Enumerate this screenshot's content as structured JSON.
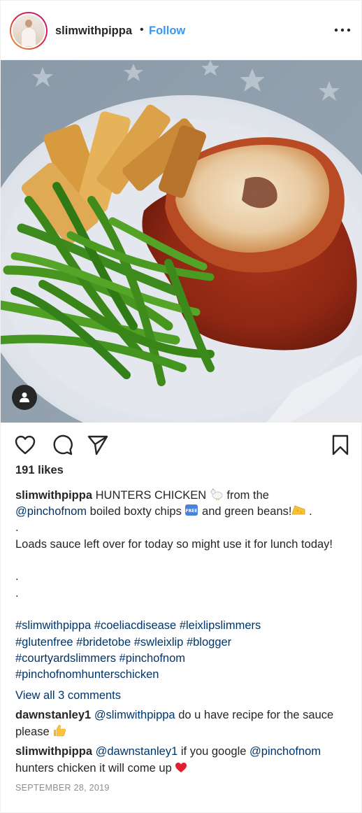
{
  "header": {
    "username": "slimwithpippa",
    "separator": "•",
    "follow_label": "Follow"
  },
  "photo": {
    "description_icon": "photo-food-plate",
    "tag_icon": "user-tag-icon"
  },
  "actions": {
    "like_icon": "heart-icon",
    "comment_icon": "comment-icon",
    "share_icon": "send-icon",
    "save_icon": "bookmark-icon"
  },
  "likes": "191 likes",
  "caption": {
    "username": "slimwithpippa",
    "line1_text": "HUNTERS CHICKEN",
    "line1_after": "from the",
    "mention": "@pinchofnom",
    "line2_text": "boiled boxty chips",
    "line2_after": "and green beans!",
    "line2_end": ".",
    "dot1": ".",
    "para": "Loads sauce left over for today so might use it for lunch today!",
    "dot2": ".",
    "dot3": ".",
    "hashtags": [
      "#slimwithpippa",
      "#coeliacdisease",
      "#leixlipslimmers",
      "#glutenfree",
      "#bridetobe",
      "#swleixlip",
      "#blogger",
      "#courtyardslimmers",
      "#pinchofnom",
      "#pinchofnomhunterschicken"
    ]
  },
  "view_all_comments": "View all 3 comments",
  "comments": [
    {
      "username": "dawnstanley1",
      "mention": "@slimwithpippa",
      "text": "do u have recipe for the sauce please"
    },
    {
      "username": "slimwithpippa",
      "mention1": "@dawnstanley1",
      "text1": "if you google",
      "mention2": "@pinchofnom",
      "text2": "hunters chicken it will come up"
    }
  ],
  "date": "SEPTEMBER 28, 2019",
  "colors": {
    "link": "#003569",
    "follow": "#3897f0",
    "text": "#262626",
    "muted": "#8e8e8e"
  }
}
